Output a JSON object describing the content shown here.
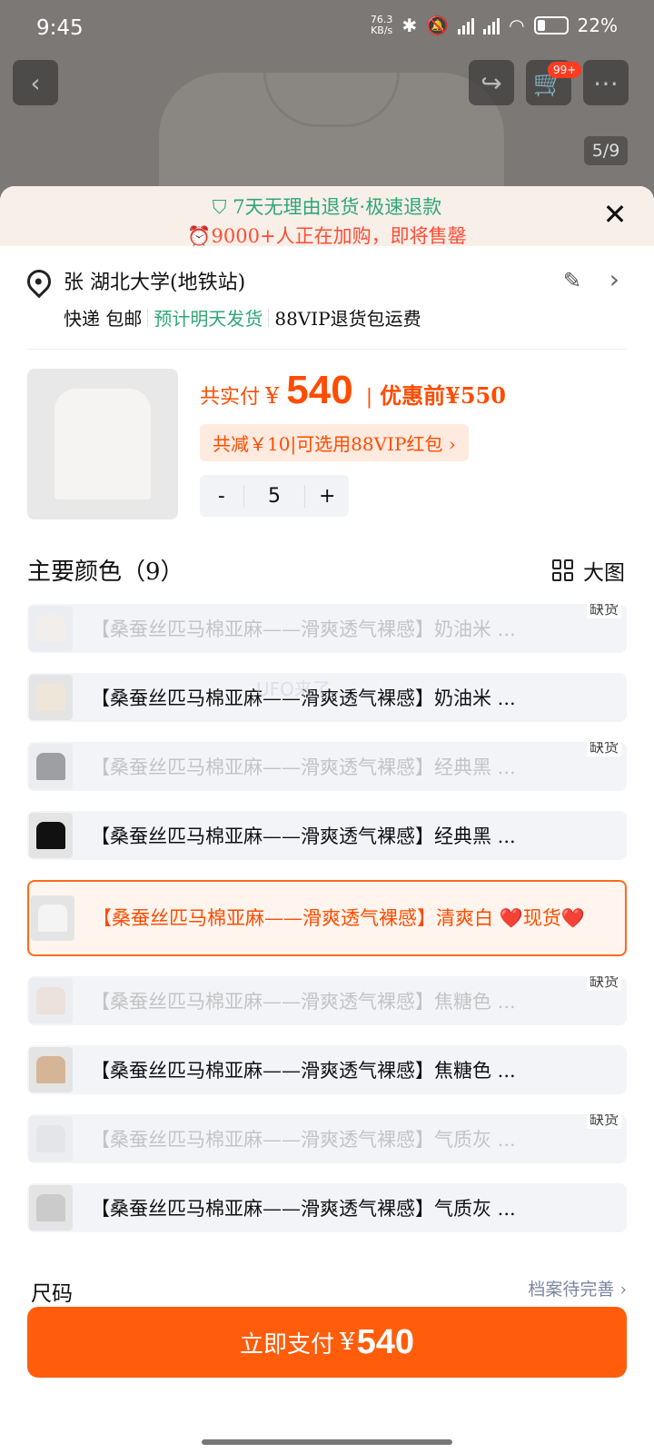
{
  "status_bar": {
    "time": "9:45",
    "net_speed_value": "76.3",
    "net_speed_unit": "KB/s",
    "battery": "22%"
  },
  "nav": {
    "cart_badge": "99+",
    "page_indicator": "5/9"
  },
  "banner": {
    "line1": "7天无理由退货·极速退款",
    "line2": "9000+人正在加购，即将售罄"
  },
  "address": {
    "name_line": "张 湖北大学(地铁站)",
    "shipping": "快递 包邮",
    "ship_time": "预计明天发货",
    "vip": "88VIP退货包运费"
  },
  "product": {
    "price_label": "共实付",
    "currency": "¥",
    "price": "540",
    "price_before": "优惠前¥550",
    "discount": "共减￥10|可选用88VIP红包 ›",
    "quantity": "5",
    "minus": "-",
    "plus": "+"
  },
  "colors": {
    "title": "主要颜色（9）",
    "big_image": "大图",
    "stock_out": "缺货",
    "options": [
      {
        "label": "【桑蚕丝匹马棉亚麻——滑爽透气裸感】奶油米 ...",
        "disabled": true,
        "color": "#efe6da"
      },
      {
        "label": "【桑蚕丝匹马棉亚麻——滑爽透气裸感】奶油米 ...",
        "disabled": false,
        "color": "#efe6da"
      },
      {
        "label": "【桑蚕丝匹马棉亚麻——滑爽透气裸感】经典黑 ...",
        "disabled": true,
        "color": "#222222"
      },
      {
        "label": "【桑蚕丝匹马棉亚麻——滑爽透气裸感】经典黑 ...",
        "disabled": false,
        "color": "#111111"
      },
      {
        "label": "【桑蚕丝匹马棉亚麻——滑爽透气裸感】清爽白 ❤️现货❤️",
        "disabled": false,
        "selected": true,
        "color": "#f4f4f4"
      },
      {
        "label": "【桑蚕丝匹马棉亚麻——滑爽透气裸感】焦糖色 ...",
        "disabled": true,
        "color": "#e0c9b2"
      },
      {
        "label": "【桑蚕丝匹马棉亚麻——滑爽透气裸感】焦糖色 ...",
        "disabled": false,
        "color": "#d6b596"
      },
      {
        "label": "【桑蚕丝匹马棉亚麻——滑爽透气裸感】气质灰 ...",
        "disabled": true,
        "color": "#cfcfcf"
      },
      {
        "label": "【桑蚕丝匹马棉亚麻——滑爽透气裸感】气质灰 ...",
        "disabled": false,
        "color": "#cbcbcb"
      }
    ]
  },
  "size": {
    "label": "尺码",
    "note": "档案待完善 ›"
  },
  "pay": {
    "label": "立即支付",
    "currency": "¥",
    "amount": "540"
  },
  "watermark": "UFO来了",
  "theme": {
    "accent": "#ff5d0b",
    "green": "#2fa777"
  }
}
